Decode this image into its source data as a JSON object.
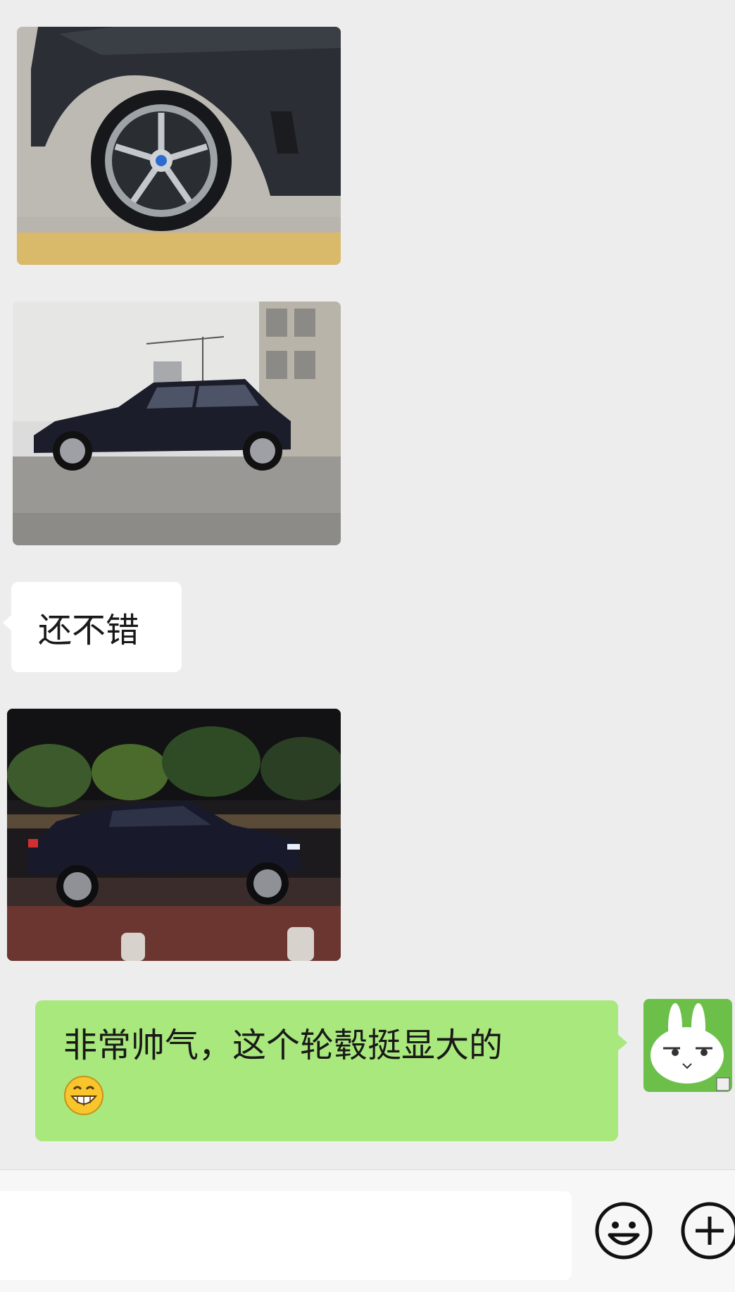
{
  "messages": {
    "left_text": "还不错",
    "right_text": "非常帅气，这个轮毂挺显大的",
    "right_emoji": "grin-emoji"
  },
  "images": [
    {
      "name": "photo-wheel-closeup",
      "alt": "car wheel closeup"
    },
    {
      "name": "photo-suv-side-day",
      "alt": "dark SUV side view daytime"
    },
    {
      "name": "photo-suv-side-night",
      "alt": "dark SUV side view at night"
    }
  ],
  "input_bar": {
    "placeholder": "",
    "emoji_button_icon": "smiley-icon",
    "plus_button_icon": "plus-circle-icon"
  },
  "colors": {
    "background": "#ededed",
    "bubble_self": "#a9e87c",
    "bubble_other": "#ffffff",
    "avatar_bg": "#6cc04a"
  }
}
